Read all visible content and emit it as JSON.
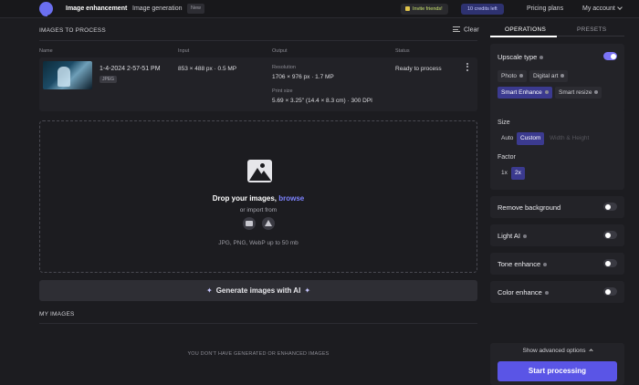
{
  "topbar": {
    "nav_enhancement": "Image enhancement",
    "nav_generation": "Image generation",
    "new_badge": "New",
    "invite": "Invite friends!",
    "credits": "10 credits left",
    "pricing": "Pricing plans",
    "account": "My account"
  },
  "images": {
    "section_title": "IMAGES TO PROCESS",
    "clear": "Clear",
    "columns": {
      "name": "Name",
      "input": "Input",
      "output": "Output",
      "status": "Status"
    },
    "rows": [
      {
        "name": "1-4-2024 2-57-51 PM",
        "format": "JPEG",
        "input": "853 × 488 px · 0.5 MP",
        "resolution_label": "Resolution",
        "resolution": "1706 × 976 px · 1.7 MP",
        "print_label": "Print size",
        "print_size": "5.69 × 3.25\" (14.4 × 8.3 cm) · 300 DPI",
        "status": "Ready to process"
      }
    ]
  },
  "drop": {
    "title": "Drop your images, ",
    "browse": "browse",
    "import": "or import from",
    "hint": "JPG, PNG, WebP up to 50 mb"
  },
  "generate": {
    "label": "Generate images with AI"
  },
  "my_images": {
    "title": "MY IMAGES",
    "empty": "YOU DON'T HAVE GENERATED OR ENHANCED IMAGES"
  },
  "panel": {
    "tabs": [
      "OPERATIONS",
      "PRESETS"
    ],
    "upscale": {
      "title": "Upscale type",
      "types": [
        "Photo",
        "Digital art",
        "Smart Enhance",
        "Smart resize"
      ],
      "selected": "Smart Enhance"
    },
    "size": {
      "label": "Size",
      "options": [
        "Auto",
        "Custom",
        "Width & Height"
      ],
      "selected": "Custom"
    },
    "factor": {
      "label": "Factor",
      "options": [
        "1x",
        "2x"
      ],
      "selected": "2x"
    },
    "remove_bg": "Remove background",
    "light_ai": "Light AI",
    "tone": "Tone enhance",
    "color": "Color enhance",
    "advanced": "Show advanced options",
    "start": "Start processing"
  }
}
